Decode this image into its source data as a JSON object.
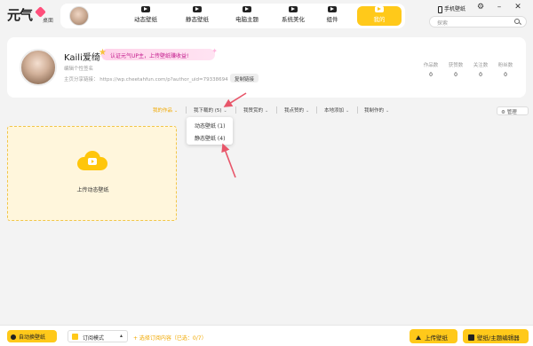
{
  "app": {
    "logo_text": "元气",
    "logo_sub": "桌面"
  },
  "nav": {
    "items": [
      {
        "label": "动态壁纸",
        "icon": "video-icon"
      },
      {
        "label": "静态壁纸",
        "icon": "image-icon"
      },
      {
        "label": "电脑主题",
        "icon": "theme-icon"
      },
      {
        "label": "系统美化",
        "icon": "beautify-icon"
      },
      {
        "label": "组件",
        "icon": "widget-icon"
      },
      {
        "label": "我的",
        "icon": "my-icon",
        "active": true
      }
    ]
  },
  "window": {
    "phone_wallpaper": "手机壁纸",
    "search_placeholder": "探索"
  },
  "profile": {
    "name": "Kaili爱绮",
    "badge": "认证元气UP主，上传壁纸赚收益!",
    "signature": "编辑个性签名",
    "share_link": "主页分享链接：  https://wp.cheetahfun.com/p?author_uid=79338694",
    "copy_button": "复制链接",
    "stats": [
      {
        "label": "作品数",
        "value": "0"
      },
      {
        "label": "获赞数",
        "value": "0"
      },
      {
        "label": "关注数",
        "value": "0"
      },
      {
        "label": "粉丝数",
        "value": "0"
      }
    ]
  },
  "tabs": [
    {
      "label": "我的作品",
      "active": true
    },
    {
      "label": "我下载的 (5)"
    },
    {
      "label": "我赞赏的"
    },
    {
      "label": "我点赞的"
    },
    {
      "label": "本地添加"
    },
    {
      "label": "我制作的"
    }
  ],
  "manage_button": "管理",
  "dropdown": {
    "items": [
      "动态壁纸 (1)",
      "静态壁纸 (4)"
    ]
  },
  "upload_card": {
    "label": "上传动态壁纸"
  },
  "bottom": {
    "auto_switch": "自动换壁纸",
    "subscribe_mode": "订阅模式",
    "select_subscription": "+ 选择订阅内容（已选：0/7）",
    "upload_button": "上传壁纸",
    "editor_button": "壁纸/主题编辑器"
  },
  "colors": {
    "accent": "#ffc91a",
    "accent_text": "#f0a800",
    "annotation_arrow": "#e8566a"
  }
}
